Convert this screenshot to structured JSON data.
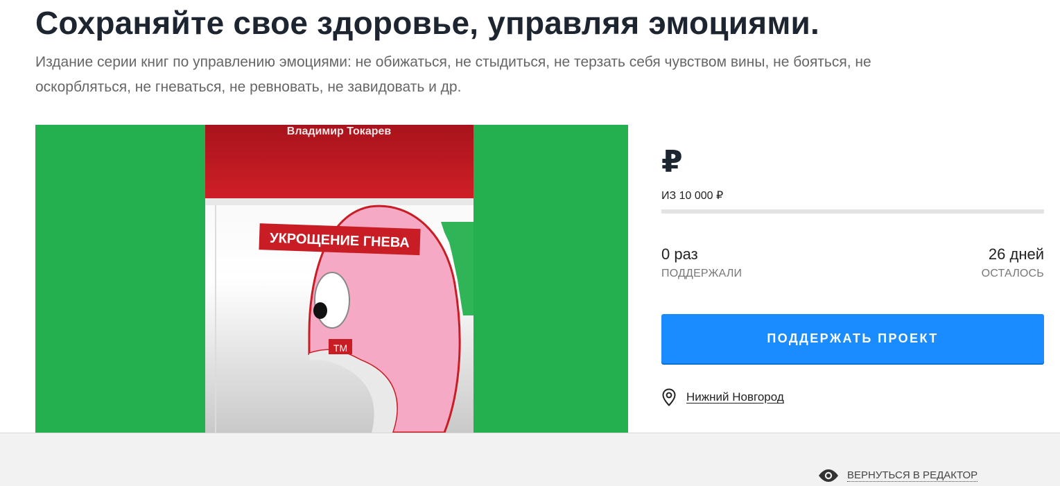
{
  "header": {
    "title": "Сохраняйте свое здоровье, управляя эмоциями.",
    "subtitle": "Издание серии книг по управлению эмоциями: не обижаться, не стыдиться, не терзать себя чувством вины, не бояться, не оскорбляться, не гневаться, не ревновать, не завидовать и др."
  },
  "cover": {
    "author": "Владимир Токарев",
    "book_title": "УКРОЩЕНИЕ ГНЕВА",
    "trademark": "ТМ",
    "colors": {
      "background": "#25b04f",
      "band": "#c81d25",
      "head": "#f6a9c4"
    }
  },
  "funding": {
    "raised_symbol": "₽",
    "goal_text": "ИЗ 10 000 ₽",
    "progress_fraction": 0,
    "supporters_value": "0 раз",
    "supporters_label": "ПОДДЕРЖАЛИ",
    "days_value": "26 дней",
    "days_label": "ОСТАЛОСЬ",
    "support_button": "ПОДДЕРЖАТЬ ПРОЕКТ",
    "location": "Нижний Новгород",
    "location_icon": "map-pin-icon"
  },
  "footer": {
    "editor_link": "ВЕРНУТЬСЯ В РЕДАКТОР",
    "editor_icon": "eye-icon"
  },
  "colors": {
    "accent": "#1a8cff",
    "title": "#1d2630"
  }
}
